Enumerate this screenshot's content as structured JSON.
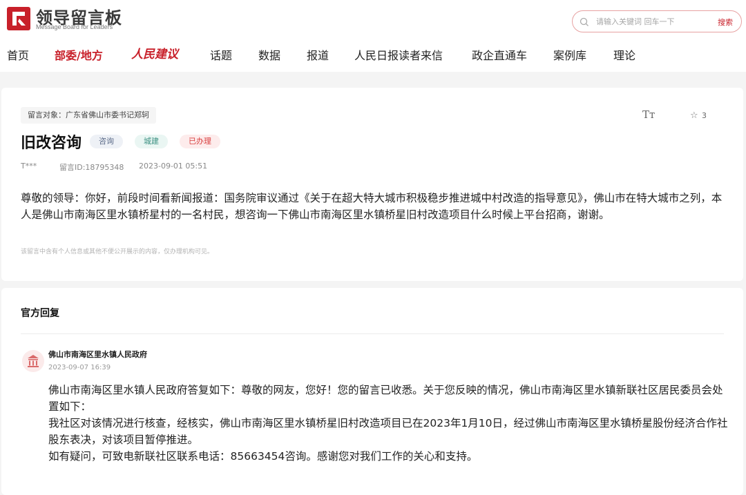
{
  "header": {
    "logo_title": "领导留言板",
    "logo_sub": "Message Board for Leaders",
    "search_placeholder": "请输入关键词 回车一下",
    "search_button": "搜索",
    "brand_color": "#c8202a"
  },
  "nav": {
    "items": [
      "首页",
      "部委/地方",
      "人民建议",
      "话题",
      "数据",
      "报道",
      "人民日报读者来信",
      "政企直通车",
      "案例库",
      "理论"
    ],
    "active_index": 1
  },
  "message": {
    "target": "留言对象：广东省佛山市委书记郑轲",
    "title": "旧改咨询",
    "tags": [
      "咨询",
      "城建",
      "已办理"
    ],
    "author": "T***",
    "message_id": "留言ID:18795348",
    "time": "2023-09-01 05:51",
    "star_count": "3",
    "font_icon_label": "Tт",
    "body": "尊敬的领导：你好，前段时间看新闻报道：国务院审议通过《关于在超大特大城市积极稳步推进城中村改造的指导意见》，佛山市在特大城市之列，本人是佛山市南海区里水镇桥星村的一名村民，想咨询一下佛山市南海区里水镇桥星旧村改造项目什么时候上平台招商，谢谢。",
    "note": "该留言中含有个人信息或其他不便公开展示的内容，仅办理机构可见。"
  },
  "reply": {
    "heading": "官方回复",
    "org": "佛山市南海区里水镇人民政府",
    "time": "2023-09-07 16:39",
    "lines": [
      "佛山市南海区里水镇人民政府答复如下：尊敬的网友，您好！您的留言已收悉。关于您反映的情况，佛山市南海区里水镇新联社区居民委员会处置如下：",
      "我社区对该情况进行核查，经核实，佛山市南海区里水镇桥星旧村改造项目已在2023年1月10日，经过佛山市南海区里水镇桥星股份经济合作社股东表决，对该项目暂停推进。",
      "如有疑问，可致电新联社区联系电话：85663454咨询。感谢您对我们工作的关心和支持。"
    ]
  }
}
